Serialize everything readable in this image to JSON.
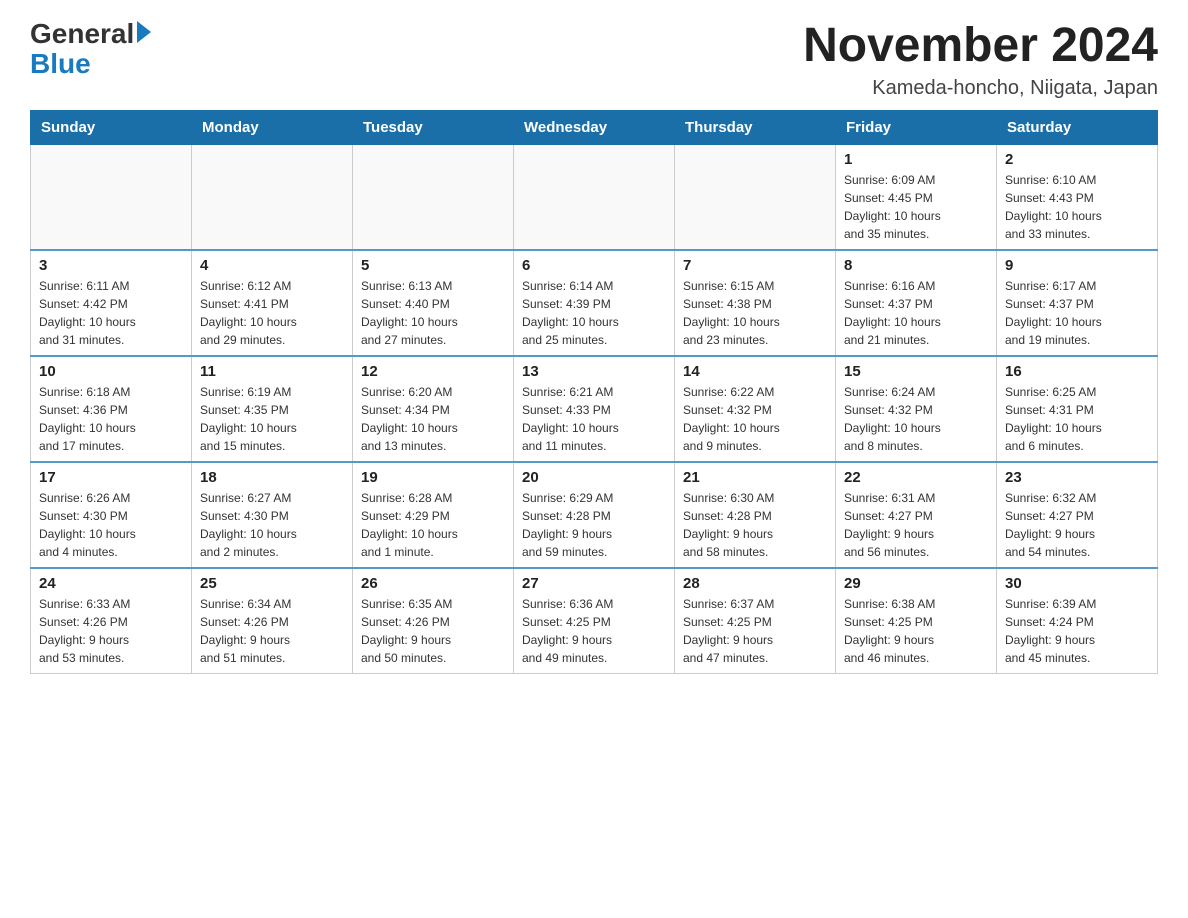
{
  "header": {
    "logo_line1": "General",
    "logo_line2": "Blue",
    "month_title": "November 2024",
    "location": "Kameda-honcho, Niigata, Japan"
  },
  "days_of_week": [
    "Sunday",
    "Monday",
    "Tuesday",
    "Wednesday",
    "Thursday",
    "Friday",
    "Saturday"
  ],
  "weeks": [
    [
      {
        "day": "",
        "info": ""
      },
      {
        "day": "",
        "info": ""
      },
      {
        "day": "",
        "info": ""
      },
      {
        "day": "",
        "info": ""
      },
      {
        "day": "",
        "info": ""
      },
      {
        "day": "1",
        "info": "Sunrise: 6:09 AM\nSunset: 4:45 PM\nDaylight: 10 hours\nand 35 minutes."
      },
      {
        "day": "2",
        "info": "Sunrise: 6:10 AM\nSunset: 4:43 PM\nDaylight: 10 hours\nand 33 minutes."
      }
    ],
    [
      {
        "day": "3",
        "info": "Sunrise: 6:11 AM\nSunset: 4:42 PM\nDaylight: 10 hours\nand 31 minutes."
      },
      {
        "day": "4",
        "info": "Sunrise: 6:12 AM\nSunset: 4:41 PM\nDaylight: 10 hours\nand 29 minutes."
      },
      {
        "day": "5",
        "info": "Sunrise: 6:13 AM\nSunset: 4:40 PM\nDaylight: 10 hours\nand 27 minutes."
      },
      {
        "day": "6",
        "info": "Sunrise: 6:14 AM\nSunset: 4:39 PM\nDaylight: 10 hours\nand 25 minutes."
      },
      {
        "day": "7",
        "info": "Sunrise: 6:15 AM\nSunset: 4:38 PM\nDaylight: 10 hours\nand 23 minutes."
      },
      {
        "day": "8",
        "info": "Sunrise: 6:16 AM\nSunset: 4:37 PM\nDaylight: 10 hours\nand 21 minutes."
      },
      {
        "day": "9",
        "info": "Sunrise: 6:17 AM\nSunset: 4:37 PM\nDaylight: 10 hours\nand 19 minutes."
      }
    ],
    [
      {
        "day": "10",
        "info": "Sunrise: 6:18 AM\nSunset: 4:36 PM\nDaylight: 10 hours\nand 17 minutes."
      },
      {
        "day": "11",
        "info": "Sunrise: 6:19 AM\nSunset: 4:35 PM\nDaylight: 10 hours\nand 15 minutes."
      },
      {
        "day": "12",
        "info": "Sunrise: 6:20 AM\nSunset: 4:34 PM\nDaylight: 10 hours\nand 13 minutes."
      },
      {
        "day": "13",
        "info": "Sunrise: 6:21 AM\nSunset: 4:33 PM\nDaylight: 10 hours\nand 11 minutes."
      },
      {
        "day": "14",
        "info": "Sunrise: 6:22 AM\nSunset: 4:32 PM\nDaylight: 10 hours\nand 9 minutes."
      },
      {
        "day": "15",
        "info": "Sunrise: 6:24 AM\nSunset: 4:32 PM\nDaylight: 10 hours\nand 8 minutes."
      },
      {
        "day": "16",
        "info": "Sunrise: 6:25 AM\nSunset: 4:31 PM\nDaylight: 10 hours\nand 6 minutes."
      }
    ],
    [
      {
        "day": "17",
        "info": "Sunrise: 6:26 AM\nSunset: 4:30 PM\nDaylight: 10 hours\nand 4 minutes."
      },
      {
        "day": "18",
        "info": "Sunrise: 6:27 AM\nSunset: 4:30 PM\nDaylight: 10 hours\nand 2 minutes."
      },
      {
        "day": "19",
        "info": "Sunrise: 6:28 AM\nSunset: 4:29 PM\nDaylight: 10 hours\nand 1 minute."
      },
      {
        "day": "20",
        "info": "Sunrise: 6:29 AM\nSunset: 4:28 PM\nDaylight: 9 hours\nand 59 minutes."
      },
      {
        "day": "21",
        "info": "Sunrise: 6:30 AM\nSunset: 4:28 PM\nDaylight: 9 hours\nand 58 minutes."
      },
      {
        "day": "22",
        "info": "Sunrise: 6:31 AM\nSunset: 4:27 PM\nDaylight: 9 hours\nand 56 minutes."
      },
      {
        "day": "23",
        "info": "Sunrise: 6:32 AM\nSunset: 4:27 PM\nDaylight: 9 hours\nand 54 minutes."
      }
    ],
    [
      {
        "day": "24",
        "info": "Sunrise: 6:33 AM\nSunset: 4:26 PM\nDaylight: 9 hours\nand 53 minutes."
      },
      {
        "day": "25",
        "info": "Sunrise: 6:34 AM\nSunset: 4:26 PM\nDaylight: 9 hours\nand 51 minutes."
      },
      {
        "day": "26",
        "info": "Sunrise: 6:35 AM\nSunset: 4:26 PM\nDaylight: 9 hours\nand 50 minutes."
      },
      {
        "day": "27",
        "info": "Sunrise: 6:36 AM\nSunset: 4:25 PM\nDaylight: 9 hours\nand 49 minutes."
      },
      {
        "day": "28",
        "info": "Sunrise: 6:37 AM\nSunset: 4:25 PM\nDaylight: 9 hours\nand 47 minutes."
      },
      {
        "day": "29",
        "info": "Sunrise: 6:38 AM\nSunset: 4:25 PM\nDaylight: 9 hours\nand 46 minutes."
      },
      {
        "day": "30",
        "info": "Sunrise: 6:39 AM\nSunset: 4:24 PM\nDaylight: 9 hours\nand 45 minutes."
      }
    ]
  ]
}
